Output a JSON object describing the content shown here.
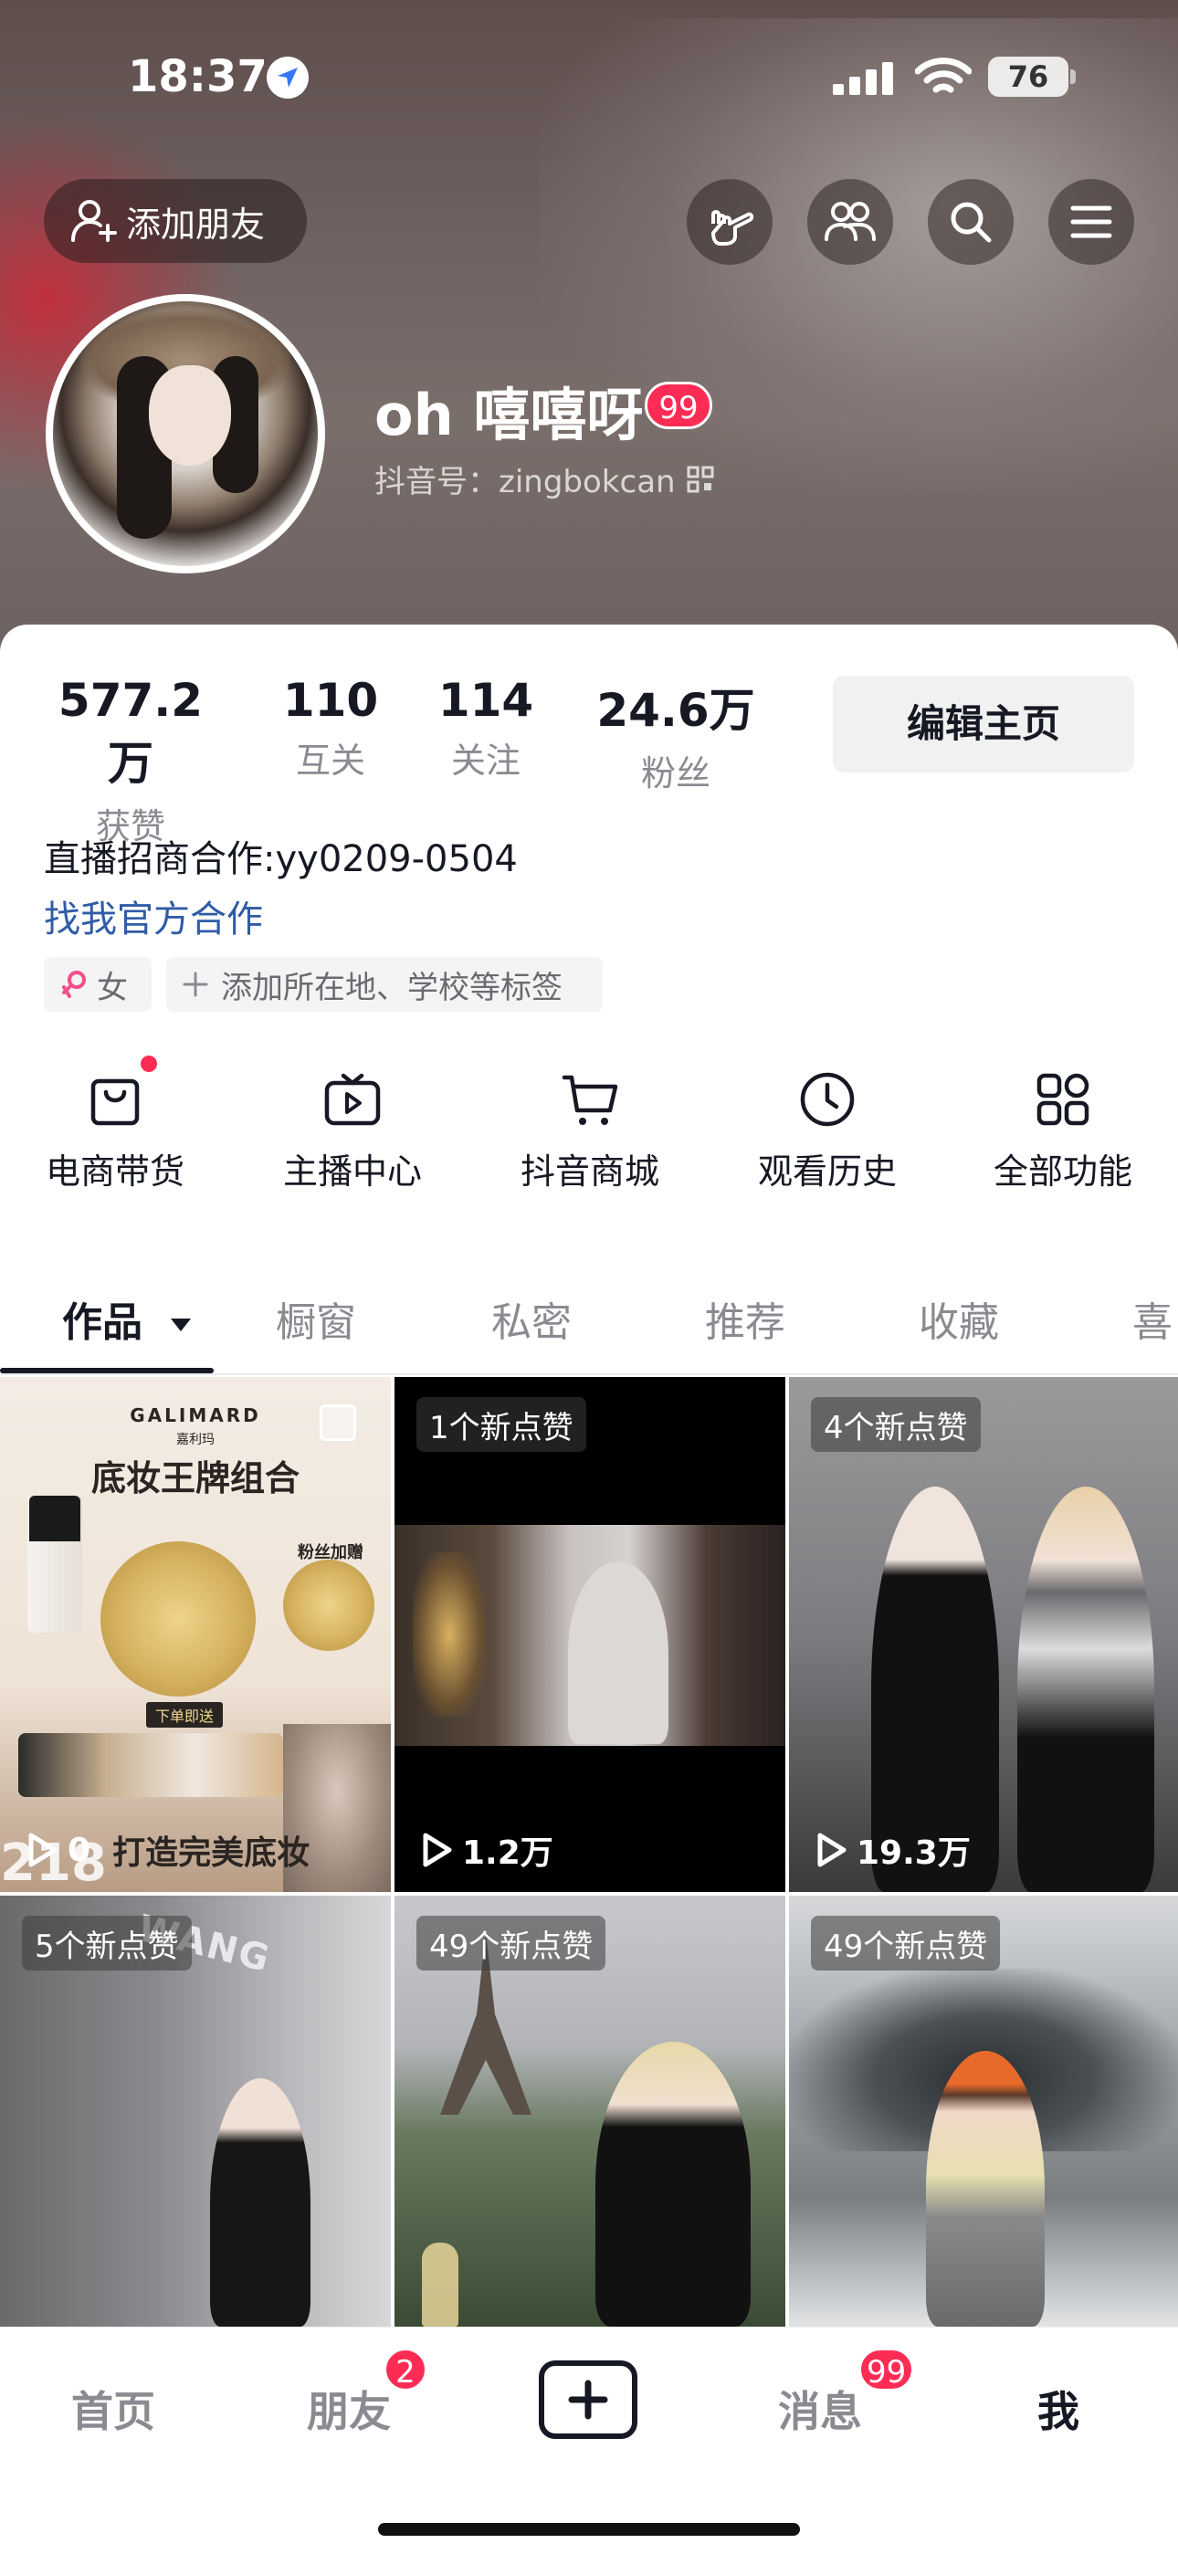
{
  "status_bar": {
    "time": "18:37",
    "battery": "76"
  },
  "header": {
    "add_friend_label": "添加朋友",
    "username": "oh 嘻嘻呀",
    "username_badge": "99",
    "douyin_id": "抖音号：zingbokcan"
  },
  "stats": [
    {
      "value": "577.2万",
      "label": "获赞"
    },
    {
      "value": "110",
      "label": "互关"
    },
    {
      "value": "114",
      "label": "关注"
    },
    {
      "value": "24.6万",
      "label": "粉丝"
    }
  ],
  "edit_profile_label": "编辑主页",
  "bio": {
    "text": "直播招商合作:yy0209-0504",
    "link": "找我官方合作"
  },
  "tags": {
    "gender": "女",
    "add_tag": "添加所在地、学校等标签"
  },
  "features": [
    {
      "label": "电商带货",
      "icon": "bag-icon"
    },
    {
      "label": "主播中心",
      "icon": "tv-play-icon"
    },
    {
      "label": "抖音商城",
      "icon": "cart-icon"
    },
    {
      "label": "观看历史",
      "icon": "clock-icon"
    },
    {
      "label": "全部功能",
      "icon": "grid-icon"
    }
  ],
  "tabs": [
    "作品",
    "橱窗",
    "私密",
    "推荐",
    "收藏",
    "喜"
  ],
  "videos": [
    {
      "brand": "GALIMARD",
      "brand_cn": "嘉利玛",
      "title": "底妆王牌组合",
      "promo": "粉丝加赠",
      "buy": "下单即送",
      "plays": "0",
      "caption": "打造完美底妆",
      "overlay_num": "218"
    },
    {
      "badge": "1个新点赞",
      "plays": "1.2万"
    },
    {
      "badge": "4个新点赞",
      "plays": "19.3万"
    },
    {
      "badge": "5个新点赞",
      "sign": "WANG"
    },
    {
      "badge": "49个新点赞"
    },
    {
      "badge": "49个新点赞"
    }
  ],
  "navbar": {
    "home": "首页",
    "friends": "朋友",
    "friends_badge": "2",
    "messages": "消息",
    "messages_badge": "99",
    "me": "我"
  },
  "colors": {
    "accent": "#fe2c55",
    "link": "#2f5ca6",
    "text": "#161823",
    "muted": "#8a8b91"
  }
}
